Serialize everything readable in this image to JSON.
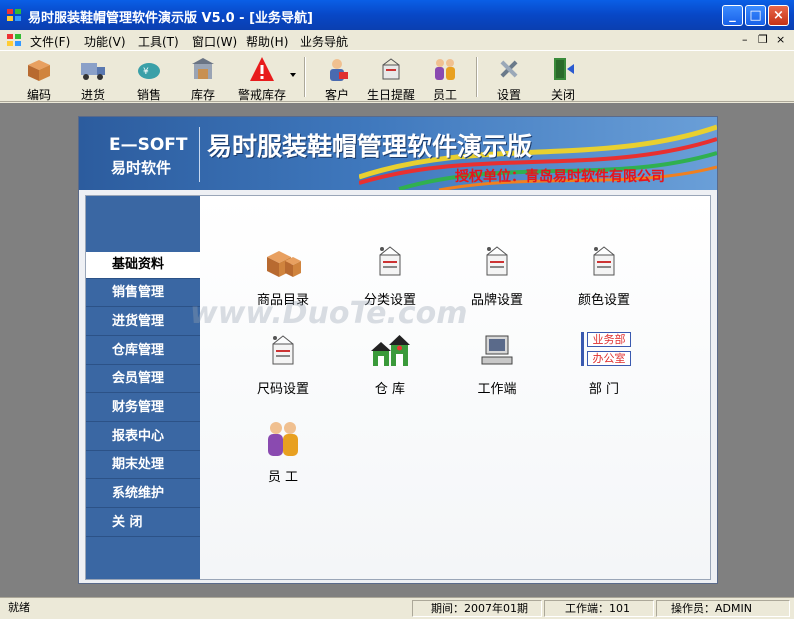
{
  "window": {
    "title": "易时服装鞋帽管理软件演示版 V5.0 - [业务导航]",
    "min_label": "_",
    "max_label": "□",
    "close_label": "×"
  },
  "menu": {
    "items": [
      "文件(F)",
      "功能(V)",
      "工具(T)",
      "窗口(W)",
      "帮助(H)",
      "业务导航"
    ],
    "mdi_min": "–",
    "mdi_restore": "❐",
    "mdi_close": "×"
  },
  "toolbar": {
    "items": [
      "编码",
      "进货",
      "销售",
      "库存",
      "警戒库存",
      "客户",
      "生日提醒",
      "员工",
      "设置",
      "关闭"
    ]
  },
  "banner": {
    "brand_en": "E—SOFT",
    "brand_cn": "易时软件",
    "product": "易时服装鞋帽管理软件演示版",
    "authorized": "授权单位：青岛易时软件有限公司"
  },
  "sidebar": {
    "items": [
      "基础资料",
      "销售管理",
      "进货管理",
      "仓库管理",
      "会员管理",
      "财务管理",
      "报表中心",
      "期末处理",
      "系统维护",
      "关    闭"
    ],
    "active_index": 0
  },
  "main": {
    "items": [
      "商品目录",
      "分类设置",
      "品牌设置",
      "颜色设置",
      "尺码设置",
      "仓    库",
      "工作端",
      "部    门",
      "员    工"
    ],
    "dept_tag1": "业务部",
    "dept_tag2": "办公室"
  },
  "watermark": "www.DuoTe.com",
  "status": {
    "state": "就绪",
    "period": "期间：2007年01期",
    "terminal": "工作端：101",
    "operator": "操作员：ADMIN"
  },
  "colors": {
    "sidebar": "#3a67a3",
    "title_bar": "#0847c6",
    "authorized_text": "#e8141c"
  }
}
